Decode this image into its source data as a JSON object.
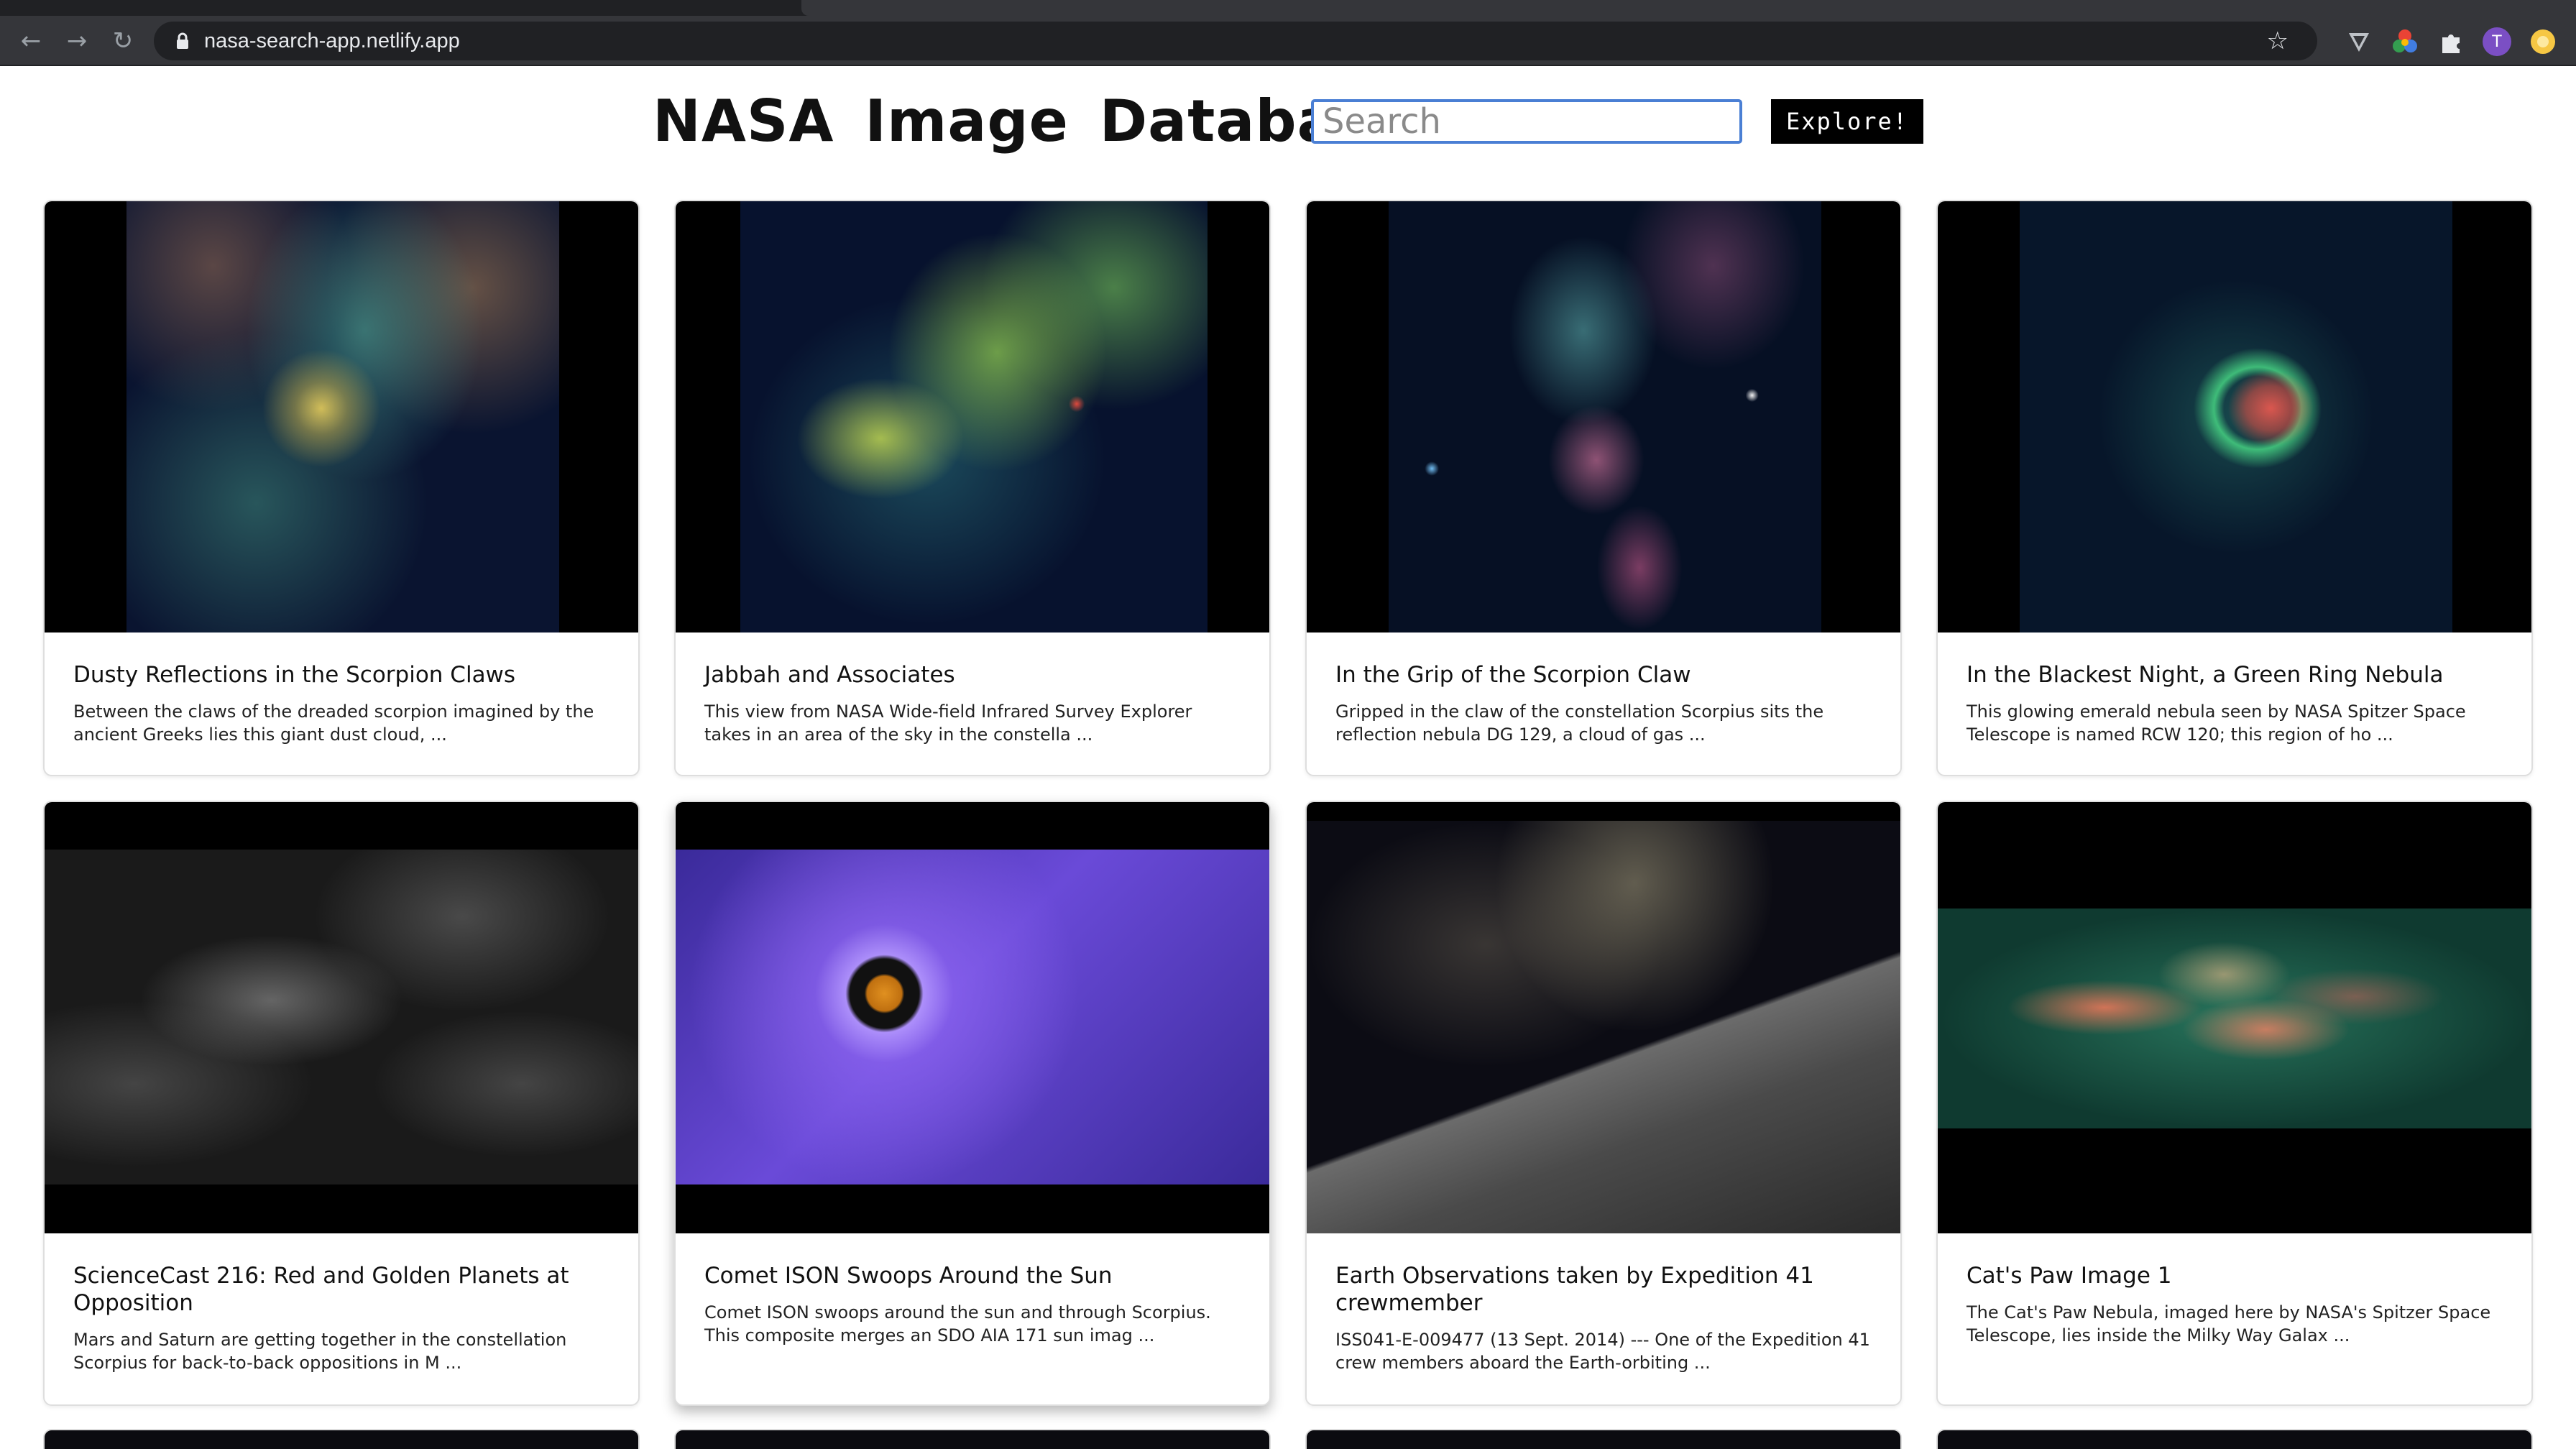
{
  "browser": {
    "url": "nasa-search-app.netlify.app",
    "profile_initial": "T",
    "icons": [
      "back-icon",
      "forward-icon",
      "reload-icon",
      "lock-icon",
      "star-icon",
      "vpn-extension-icon",
      "color-extension-icon",
      "puzzle-extension-icon",
      "avatar",
      "extension-icon"
    ]
  },
  "header": {
    "title": "NASA Image Database",
    "search_placeholder": "Search",
    "search_value": "",
    "explore_label": "Explore!"
  },
  "cards": [
    {
      "title": "Dusty Reflections in the Scorpion Claws",
      "description": "Between the claws of the dreaded scorpion imagined by the ancient Greeks lies this giant dust cloud, ...",
      "image": "nebula-teal-yellow"
    },
    {
      "title": "Jabbah and Associates",
      "description": "This view from NASA Wide-field Infrared Survey Explorer takes in an area of the sky in the constella ...",
      "image": "nebula-green-cloud"
    },
    {
      "title": "In the Grip of the Scorpion Claw",
      "description": "Gripped in the claw of the constellation Scorpius sits the reflection nebula DG 129, a cloud of gas ...",
      "image": "nebula-pink-blue"
    },
    {
      "title": "In the Blackest Night, a Green Ring Nebula",
      "description": "This glowing emerald nebula seen by NASA Spitzer Space Telescope is named RCW 120; this region of ho ...",
      "image": "nebula-green-ring"
    },
    {
      "title": "ScienceCast 216: Red and Golden Planets at Opposition",
      "description": "Mars and Saturn are getting together in the constellation Scorpius for back-to-back oppositions in M ...",
      "image": "scorpius-constellation-art"
    },
    {
      "title": "Comet ISON Swoops Around the Sun",
      "description": "Comet ISON swoops around the sun and through Scorpius. This composite merges an SDO AIA 171 sun imag ...",
      "image": "sun-coronagraph-purple"
    },
    {
      "title": "Earth Observations taken by Expedition 41 crewmember",
      "description": "ISS041-E-009477 (13 Sept. 2014) --- One of the Expedition 41 crew members aboard the Earth-orbiting ...",
      "image": "iss-milky-way"
    },
    {
      "title": "Cat's Paw Image 1",
      "description": "The Cat's Paw Nebula, imaged here by NASA's Spitzer Space Telescope, lies inside the Milky Way Galax ...",
      "image": "cats-paw-nebula"
    }
  ],
  "colors": {
    "search_border": "#4a7fd4",
    "button_bg": "#000000",
    "card_border": "#dedede",
    "chrome_bg": "#35363a"
  }
}
